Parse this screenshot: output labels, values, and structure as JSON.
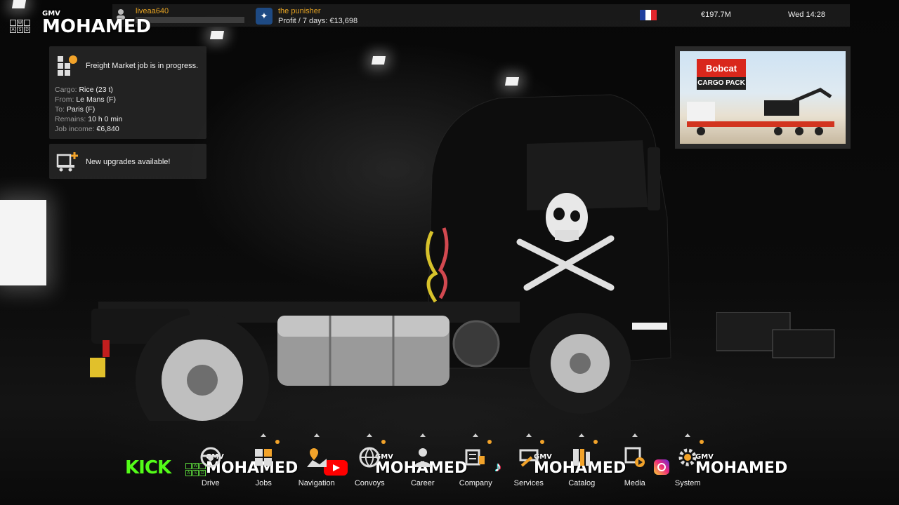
{
  "topbar": {
    "player_name": "liveaa640",
    "company_name": "the punisher",
    "company_logo_glyph": "✦",
    "profit_label": "Profit / 7 days: €13,698",
    "flag_colors": [
      "#1f3f9e",
      "#ffffff",
      "#e1262d"
    ],
    "money": "€197.7M",
    "datetime": "Wed 14:28"
  },
  "watermark": {
    "gmv": "GMV",
    "name": "MOHAMED",
    "keys": [
      "W",
      "A",
      "S",
      "D"
    ]
  },
  "job_panel": {
    "title": "Freight Market job is in progress.",
    "cargo_label": "Cargo:",
    "cargo_value": "Rice (23 t)",
    "from_label": "From:",
    "from_value": "Le Mans (F)",
    "to_label": "To:",
    "to_value": "Paris (F)",
    "remains_label": "Remains:",
    "remains_value": "10 h 0 min",
    "income_label": "Job income:",
    "income_value": "€6,840"
  },
  "upgrades_panel": {
    "text": "New upgrades available!"
  },
  "promo": {
    "brand": "Bobcat",
    "subtitle": "CARGO PACK"
  },
  "social": {
    "kick": "KICK",
    "tiktok_glyph": "♪"
  },
  "menu": {
    "items": [
      {
        "label": "Drive",
        "icon": "steering-wheel-icon",
        "notify": false
      },
      {
        "label": "Jobs",
        "icon": "jobs-grid-icon",
        "notify": true
      },
      {
        "label": "Navigation",
        "icon": "map-pin-icon",
        "notify": false
      },
      {
        "label": "Convoys",
        "icon": "globe-icon",
        "notify": true
      },
      {
        "label": "Career",
        "icon": "person-icon",
        "notify": false
      },
      {
        "label": "Company",
        "icon": "company-icon",
        "notify": true
      },
      {
        "label": "Services",
        "icon": "services-icon",
        "notify": true
      },
      {
        "label": "Catalog",
        "icon": "catalog-icon",
        "notify": true
      },
      {
        "label": "Media",
        "icon": "media-icon",
        "notify": false
      },
      {
        "label": "System",
        "icon": "gear-icon",
        "notify": true
      }
    ]
  },
  "colors": {
    "accent": "#e7a423",
    "notify_dot": "#f2a32a",
    "panel_bg": "#262626",
    "kick_green": "#53fc18"
  }
}
